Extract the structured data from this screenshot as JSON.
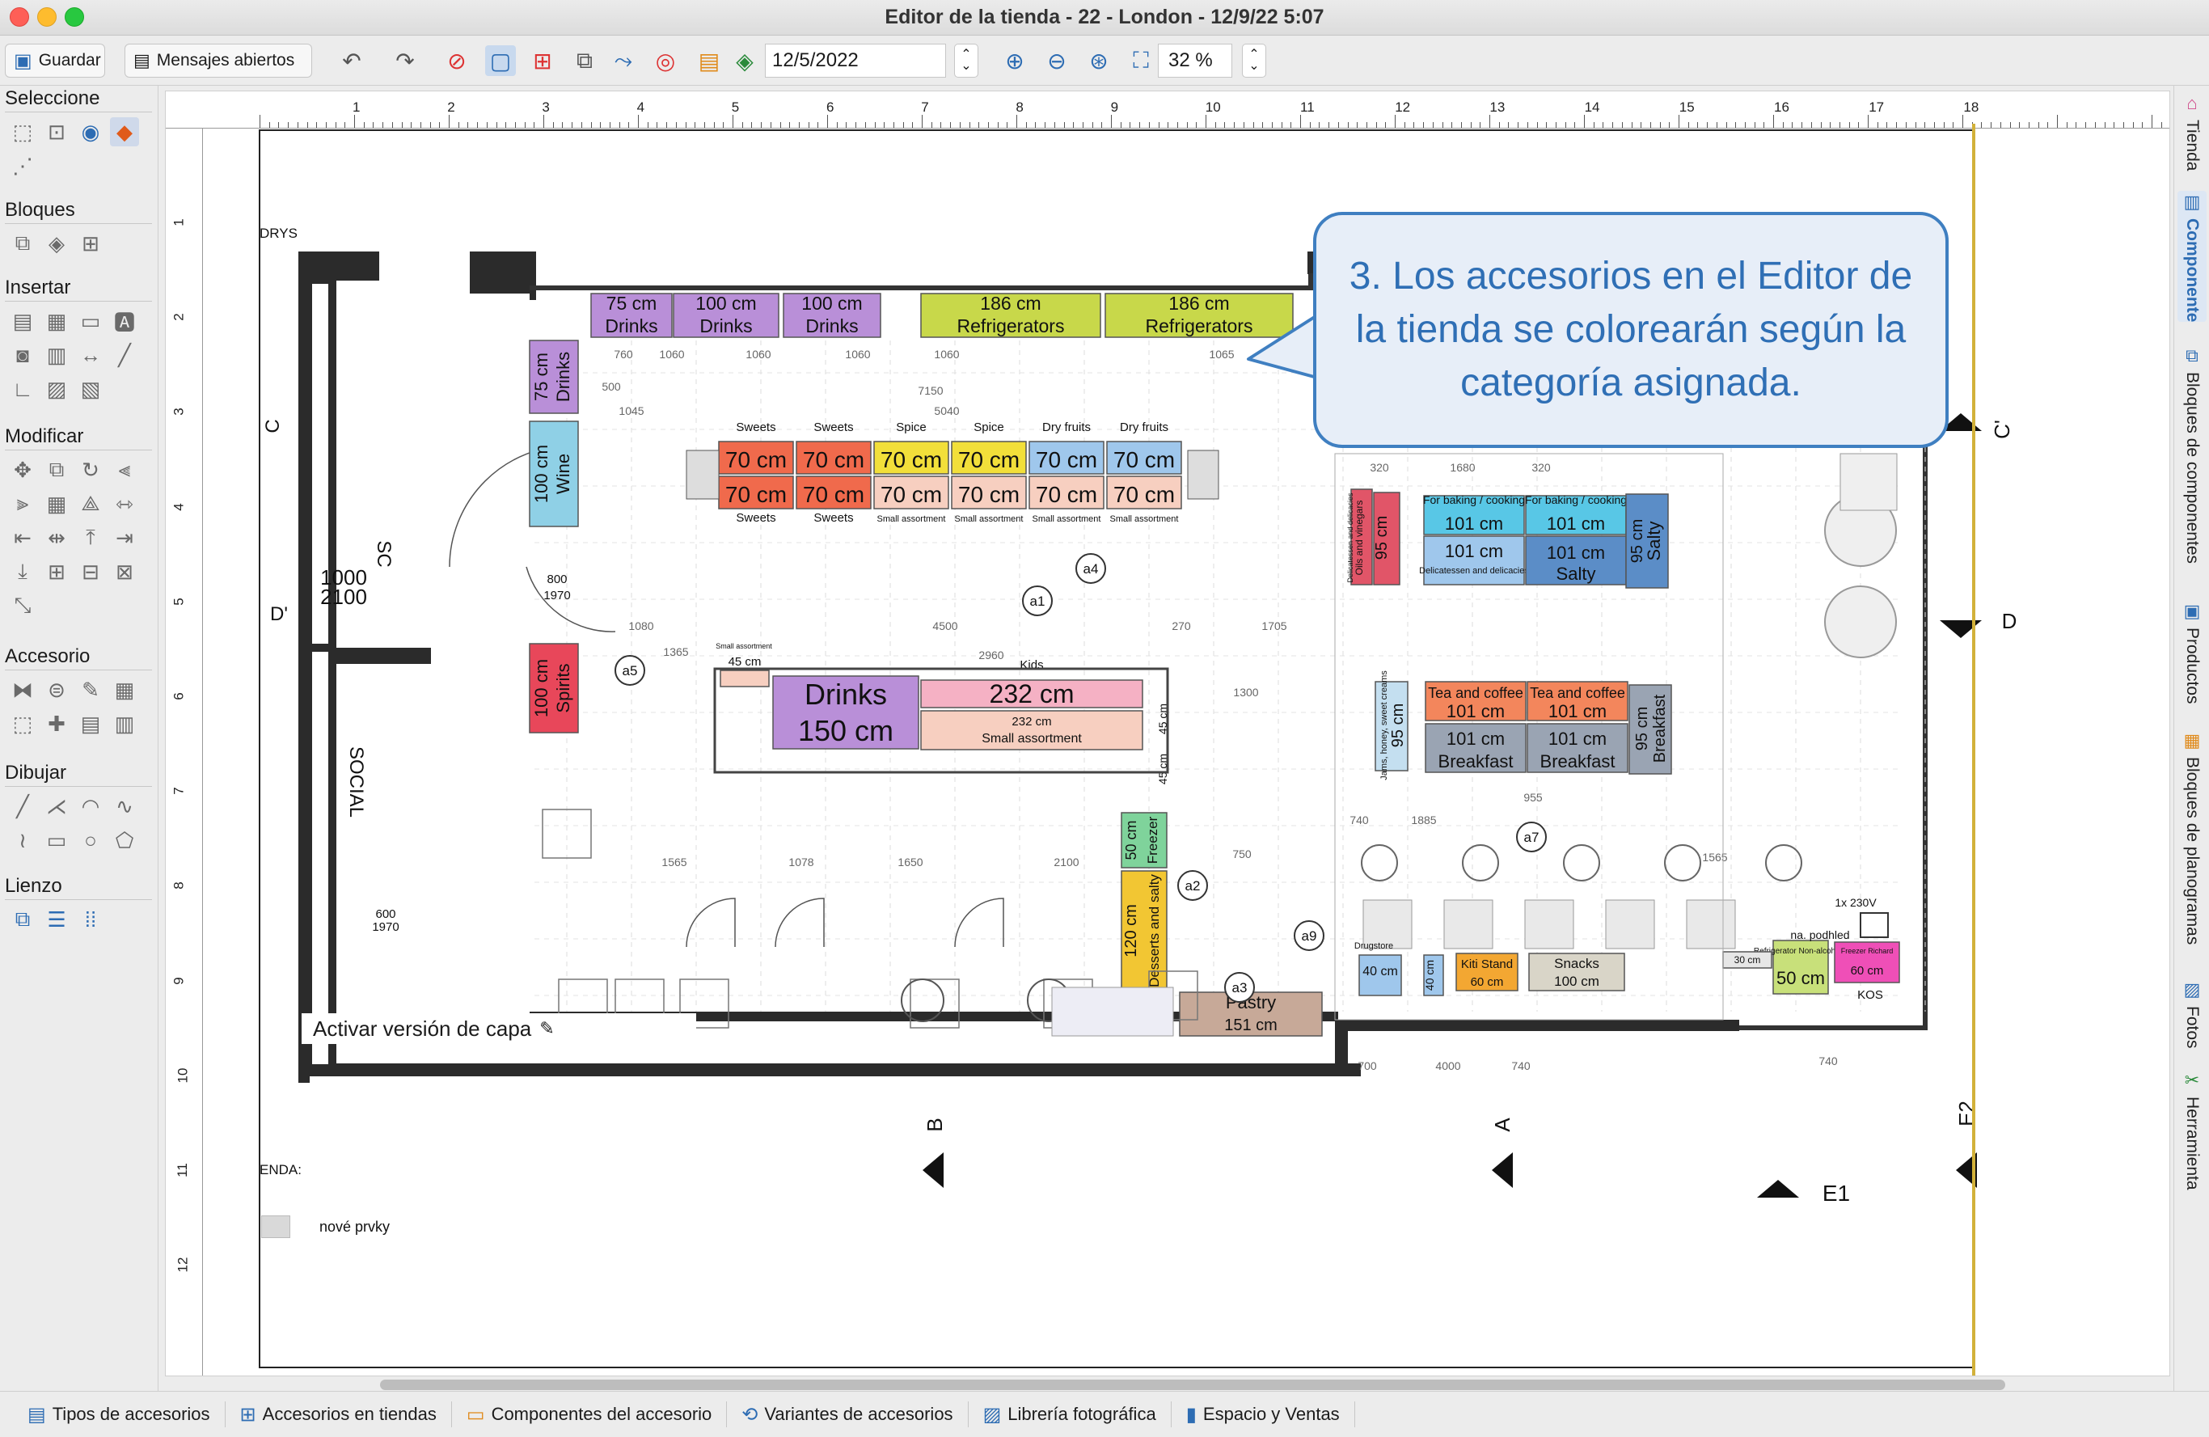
{
  "window": {
    "title": "Editor de la tienda - 22 - London - 12/9/22 5:07"
  },
  "toolbar": {
    "save_label": "Guardar",
    "messages_label": "Mensajes abiertos",
    "date_value": "12/5/2022",
    "zoom_value": "32 %"
  },
  "left_panel": {
    "groups": [
      "Seleccione",
      "Bloques",
      "Insertar",
      "Modificar",
      "Accesorio",
      "Dibujar",
      "Lienzo"
    ]
  },
  "right_tabs": [
    "Tienda",
    "Componente",
    "Bloques de componentes",
    "Productos",
    "Bloques de planogramas",
    "Fotos",
    "Herramienta"
  ],
  "bottom_tabs": [
    "Tipos de accesorios",
    "Accesorios en tiendas",
    "Componentes del accesorio",
    "Variantes de accesorios",
    "Librería fotográfica",
    "Espacio y Ventas"
  ],
  "canvas": {
    "ruler_top": [
      "1",
      "2",
      "3",
      "4",
      "5",
      "6",
      "7",
      "8",
      "9",
      "10",
      "11",
      "12",
      "13",
      "14",
      "15",
      "16",
      "17",
      "18"
    ],
    "ruler_left": [
      "1",
      "2",
      "3",
      "4",
      "5",
      "6",
      "7",
      "8",
      "9",
      "10",
      "11",
      "12"
    ],
    "callout_text": "3. Los accesorios en el Editor de la tienda se colorearán según la categoría asignada.",
    "layer_version_label": "Activar versión de capa",
    "legend_title": "ENDA:",
    "legend_item": "nové prvky",
    "corner_label": "DRYS",
    "section_labels": {
      "b": "B",
      "a": "A",
      "e1": "E1",
      "e2": "E2",
      "c": "C",
      "c_right": "C'",
      "d": "D",
      "d_left": "D'"
    },
    "markers": [
      "a1",
      "a2",
      "a3",
      "a4",
      "a5",
      "a7",
      "a9"
    ],
    "fixtures": {
      "top_row": [
        {
          "size": "75 cm",
          "cat": "Drinks",
          "color": "#b98fd8"
        },
        {
          "size": "100 cm",
          "cat": "Drinks",
          "color": "#b98fd8"
        },
        {
          "size": "100 cm",
          "cat": "Drinks",
          "color": "#b98fd8"
        },
        {
          "size": "186 cm",
          "cat": "Refrigerators",
          "color": "#c8d84a"
        },
        {
          "size": "186 cm",
          "cat": "Refrigerators",
          "color": "#c8d84a"
        }
      ],
      "left_wall": [
        {
          "size": "75 cm",
          "cat": "Drinks",
          "color": "#b98fd8"
        },
        {
          "size": "100 cm",
          "cat": "Wine",
          "color": "#8fd0e6"
        },
        {
          "size": "100 cm",
          "cat": "Spirits",
          "color": "#e8475a"
        }
      ],
      "gondola_top_labels": [
        "Sweets",
        "Sweets",
        "Spice",
        "Spice",
        "Dry fruits",
        "Dry fruits"
      ],
      "gondola_bottom_labels": [
        "Sweets",
        "Sweets",
        "Small assortment",
        "Small assortment",
        "Small assortment",
        "Small assortment"
      ],
      "gondola_size": "70 cm",
      "gondola_colors": [
        "#f06a4c",
        "#f06a4c",
        "#f2df3a",
        "#f2df3a",
        "#9fc7ec",
        "#9fc7ec"
      ],
      "gondola_bottom_colors": [
        "#f06a4c",
        "#f06a4c",
        "#f7cfc0",
        "#f7cfc0",
        "#f7cfc0",
        "#f7cfc0"
      ],
      "drinks_150": {
        "cat": "Drinks",
        "size": "150 cm"
      },
      "kids_label": "Kids",
      "kids_232": "232 cm",
      "small_232": "232 cm",
      "small_assortment": "Small assortment",
      "small_45": "45 cm",
      "small_tag": "Small assortment",
      "freezer": {
        "size": "50 cm",
        "cat": "Freezer"
      },
      "desserts": {
        "size": "120 cm",
        "cat": "Desserts and salty"
      },
      "pastry": {
        "cat": "Pastry",
        "size": "151 cm"
      },
      "side_45": "45 cm",
      "right_group_top": [
        {
          "text1": "For baking / cooking",
          "text2": "101 cm"
        },
        {
          "text1": "For baking / cooking",
          "text2": "101 cm"
        },
        {
          "text1": "101 cm",
          "text2": "Delicatessen and delicacies"
        },
        {
          "text1": "101 cm",
          "text2": "Salty"
        }
      ],
      "oils_label": "Oils and vinegars",
      "oils_sub": "Delicatessen and delicacies",
      "cm95": "95 cm",
      "salty_label": "Salty",
      "tea": "Tea and coffee",
      "breakfast": "Breakfast",
      "cm101": "101 cm",
      "jams": "Jams, honey, sweet creams",
      "drugstore": "Drugstore",
      "cm40": "40 cm",
      "kiti": {
        "cat": "Kiti Stand",
        "size": "60 cm"
      },
      "snacks": {
        "cat": "Snacks",
        "size": "100 cm"
      },
      "refrigerator_na": "Refrigerator Non-alcoholic",
      "cm50": "50 cm",
      "cm30": "30 cm",
      "freezer_richard": "Freezer Richard",
      "cm60": "60 cm",
      "kos": "KOS",
      "power_label": "1x 230V",
      "podhled": "na. podhled"
    },
    "door_labels": {
      "d1": "1000",
      "d2": "2100",
      "d3": "800",
      "d4": "1970",
      "d5": "600",
      "d6": "1970"
    },
    "vertical_labels": {
      "v1": "SC",
      "v2": "SOCIAL"
    },
    "dims_top": [
      "760",
      "1060",
      "1060",
      "1060",
      "1060",
      "7150",
      "5040",
      "1065",
      "1045",
      "500",
      "320",
      "1680",
      "320",
      "1080",
      "4500",
      "270",
      "1705",
      "1365",
      "2960",
      "1300",
      "1565",
      "1078",
      "1650",
      "2100",
      "750",
      "1565",
      "955",
      "700",
      "4000",
      "740",
      "740",
      "740",
      "1885",
      "500",
      "1000"
    ],
    "colors": {
      "accent": "#2d6cb3",
      "drinks": "#b98fd8",
      "refrigerators": "#c8d84a",
      "wine": "#8fd0e6",
      "spirits": "#e8475a",
      "sweets": "#f06a4c",
      "spice": "#f2df3a",
      "dry_fruits": "#9fc7ec",
      "small_assortment": "#f7cfc0",
      "kids": "#f5b1c4",
      "freezer": "#7fd39b",
      "desserts": "#f2c633",
      "pastry": "#c7a998",
      "salty": "#5b8dc7",
      "breakfast": "#9aa4b3",
      "tea": "#f3865c",
      "baking": "#58c7e6",
      "oils": "#e15568",
      "kiti": "#f3a732",
      "snacks": "#d9d5c8",
      "pink": "#ef4fb7",
      "green_refrig": "#c8e07a"
    }
  }
}
